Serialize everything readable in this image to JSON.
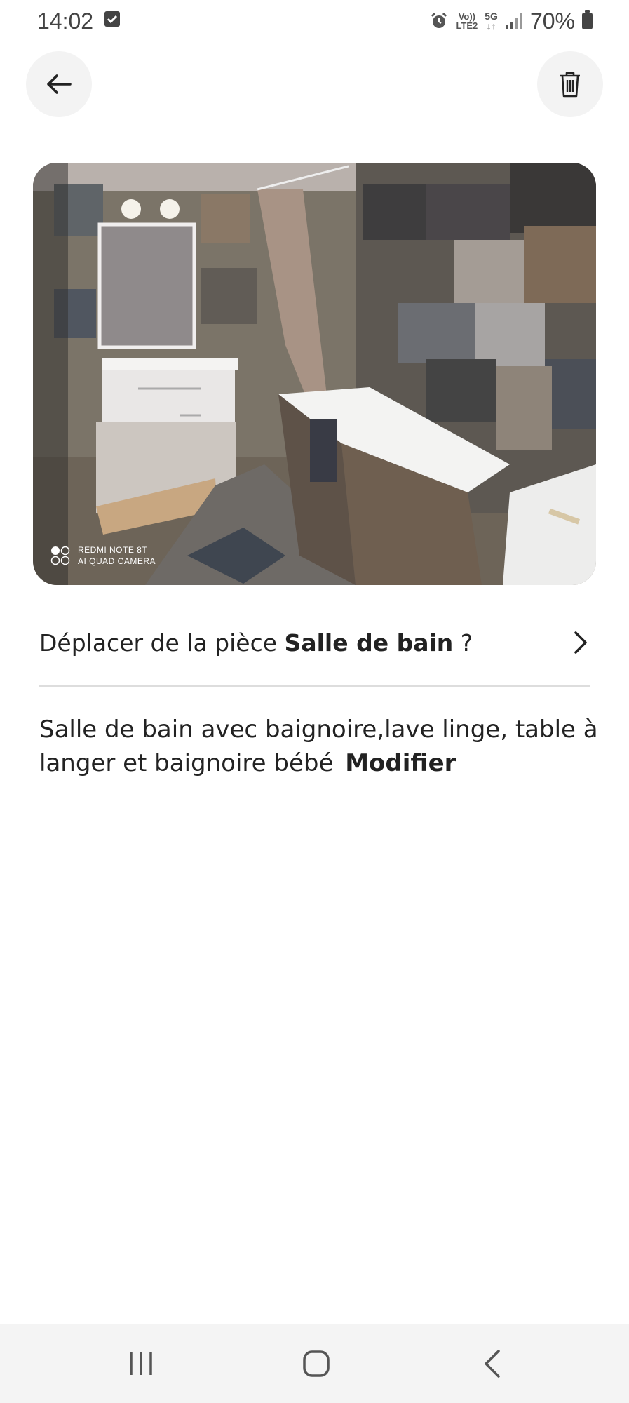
{
  "status_bar": {
    "time": "14:02",
    "volte_top": "Vo))",
    "volte_bottom": "LTE2",
    "network": "5G",
    "battery": "70%"
  },
  "icons": {
    "back": "arrow-left-icon",
    "delete": "trash-icon",
    "chevron": "chevron-right-icon"
  },
  "photo": {
    "watermark_line1": "REDMI NOTE 8T",
    "watermark_line2": "AI QUAD CAMERA"
  },
  "move_room": {
    "prefix": "Déplacer de la pièce",
    "room": "Salle de bain",
    "suffix": "?"
  },
  "description": {
    "text": "Salle de bain avec baignoire,lave linge, table à langer et baignoire bébé",
    "edit_label": "Modifier"
  },
  "colors": {
    "text": "#222222",
    "divider": "#dddddd",
    "button_bg": "#f3f3f3",
    "nav_bg": "#f4f4f4"
  }
}
